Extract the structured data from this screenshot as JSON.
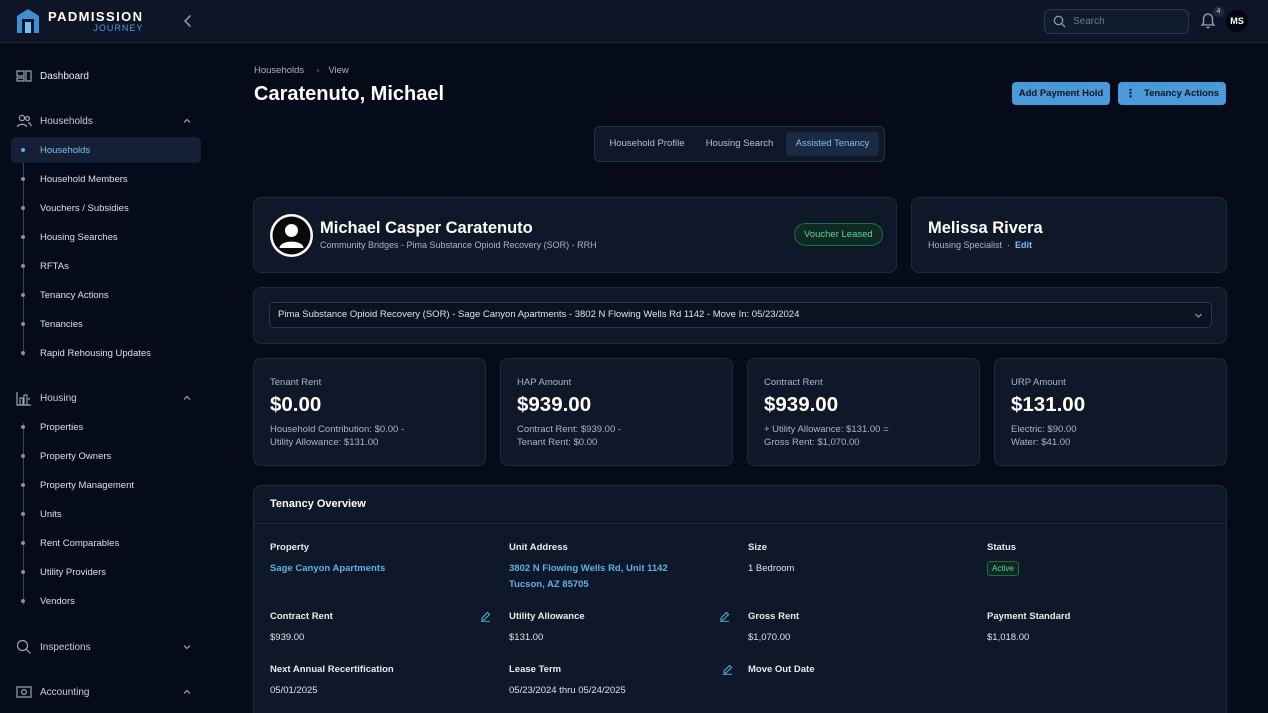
{
  "app": {
    "logo_title": "PADMISSION",
    "logo_sub": "JOURNEY"
  },
  "topbar": {
    "search_placeholder": "Search",
    "notification_count": "4",
    "user_initials": "MS"
  },
  "sidebar": {
    "dashboard": "Dashboard",
    "households_group": "Households",
    "households_items": [
      "Households",
      "Household Members",
      "Vouchers / Subsidies",
      "Housing Searches",
      "RFTAs",
      "Tenancy Actions",
      "Tenancies",
      "Rapid Rehousing Updates"
    ],
    "housing_group": "Housing",
    "housing_items": [
      "Properties",
      "Property Owners",
      "Property Management",
      "Units",
      "Rent Comparables",
      "Utility Providers",
      "Vendors"
    ],
    "inspections_group": "Inspections",
    "accounting_group": "Accounting"
  },
  "breadcrumb": {
    "parent": "Households",
    "current": "View"
  },
  "page_title": "Caratenuto, Michael",
  "actions": {
    "add_payment_hold": "Add Payment Hold",
    "tenancy_actions": "Tenancy Actions"
  },
  "tabs": [
    "Household Profile",
    "Housing Search",
    "Assisted Tenancy"
  ],
  "household": {
    "name": "Michael Casper Caratenuto",
    "program": "Community Bridges - Pima Substance Opioid Recovery (SOR) - RRH",
    "status": "Voucher Leased"
  },
  "specialist": {
    "name": "Melissa Rivera",
    "role": "Housing Specialist",
    "dot": "·",
    "edit": "Edit"
  },
  "tenancy_select": "Pima Substance Opioid Recovery (SOR) - Sage Canyon Apartments - 3802 N Flowing Wells Rd 1142 - Move In: 05/23/2024",
  "metrics": [
    {
      "label": "Tenant Rent",
      "value": "$0.00",
      "desc": "Household Contribution: $0.00 -\nUtility Allowance: $131.00"
    },
    {
      "label": "HAP Amount",
      "value": "$939.00",
      "desc": "Contract Rent: $939.00 -\nTenant Rent: $0.00"
    },
    {
      "label": "Contract Rent",
      "value": "$939.00",
      "desc": "+ Utility Allowance: $131.00 =\nGross Rent: $1,070.00"
    },
    {
      "label": "URP Amount",
      "value": "$131.00",
      "desc": "Electric: $90.00\nWater: $41.00"
    }
  ],
  "overview": {
    "title": "Tenancy Overview",
    "property_label": "Property",
    "property_value": "Sage Canyon Apartments",
    "address_label": "Unit Address",
    "address_line1": "3802 N Flowing Wells Rd, Unit 1142",
    "address_line2": "Tucson, AZ 85705",
    "size_label": "Size",
    "size_value": "1 Bedroom",
    "status_label": "Status",
    "status_value": "Active",
    "contract_rent_label": "Contract Rent",
    "contract_rent_value": "$939.00",
    "utility_label": "Utility Allowance",
    "utility_value": "$131.00",
    "gross_label": "Gross Rent",
    "gross_value": "$1,070.00",
    "payment_std_label": "Payment Standard",
    "payment_std_value": "$1,018.00",
    "recert_label": "Next Annual Recertification",
    "recert_value": "05/01/2025",
    "lease_label": "Lease Term",
    "lease_value": "05/23/2024 thru 05/24/2025",
    "moveout_label": "Move Out Date"
  }
}
